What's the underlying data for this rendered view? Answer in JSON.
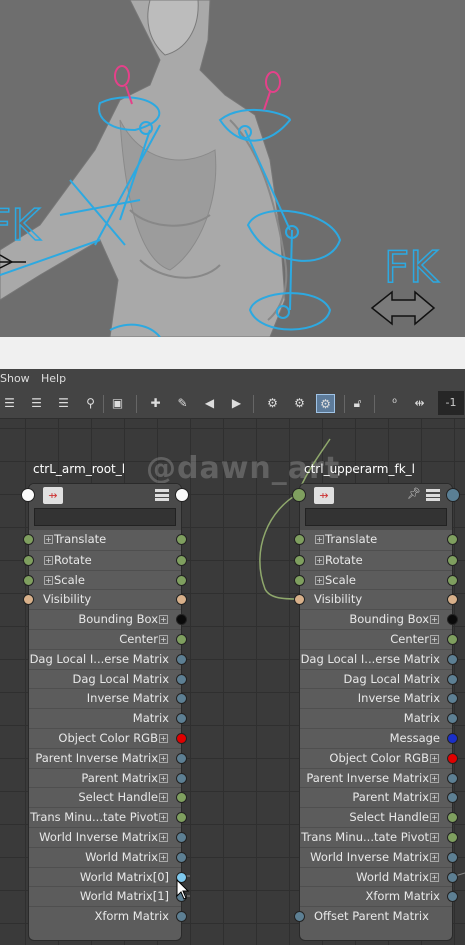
{
  "viewport": {
    "fk_label": "FK",
    "fk_label_left": "FK",
    "colors": {
      "rig": "#2da9e1",
      "locator": "#e5418a",
      "background": "#6e6e6e"
    }
  },
  "menu": {
    "items": [
      "Show",
      "Help"
    ]
  },
  "toolbar": {
    "icons": [
      "layout-icon",
      "list-icon",
      "columns-icon",
      "search-icon",
      "frame-icon",
      "add-node-icon",
      "edit-node-icon",
      "prev-icon",
      "next-icon",
      "input-connections-icon",
      "output-connections-icon",
      "graph-icon",
      "lock-icon",
      "zero-icon",
      "spread-icon"
    ],
    "zoom_value": "-1"
  },
  "canvas": {
    "watermark": "@dawn_art",
    "nodes": [
      {
        "title": "ctrL_arm_root_l",
        "rows": [
          {
            "label": "Translate",
            "side": "in",
            "plus": true,
            "left": "green",
            "right": "green"
          },
          {
            "label": "Rotate",
            "side": "in",
            "plus": true,
            "left": "green",
            "right": "green"
          },
          {
            "label": "Scale",
            "side": "in",
            "plus": true,
            "left": "green",
            "right": "green"
          },
          {
            "label": "Visibility",
            "side": "in",
            "plus": false,
            "left": "tan",
            "right": "tan"
          },
          {
            "label": "Bounding Box",
            "side": "out",
            "plus": true,
            "left": "",
            "right": "black"
          },
          {
            "label": "Center",
            "side": "out",
            "plus": true,
            "left": "",
            "right": "green"
          },
          {
            "label": "Dag Local I...erse Matrix",
            "side": "out",
            "plus": false,
            "left": "",
            "right": "blue"
          },
          {
            "label": "Dag Local Matrix",
            "side": "out",
            "plus": false,
            "left": "",
            "right": "blue"
          },
          {
            "label": "Inverse Matrix",
            "side": "out",
            "plus": false,
            "left": "",
            "right": "blue"
          },
          {
            "label": "Matrix",
            "side": "out",
            "plus": false,
            "left": "",
            "right": "blue"
          },
          {
            "label": "Object Color RGB",
            "side": "out",
            "plus": true,
            "left": "",
            "right": "red"
          },
          {
            "label": "Parent Inverse Matrix",
            "side": "out",
            "plus": true,
            "left": "",
            "right": "blue"
          },
          {
            "label": "Parent Matrix",
            "side": "out",
            "plus": true,
            "left": "",
            "right": "blue"
          },
          {
            "label": "Select Handle",
            "side": "out",
            "plus": true,
            "left": "",
            "right": "green"
          },
          {
            "label": "Trans Minu...tate Pivot",
            "side": "out",
            "plus": true,
            "left": "",
            "right": "green"
          },
          {
            "label": "World Inverse Matrix",
            "side": "out",
            "plus": true,
            "left": "",
            "right": "blue"
          },
          {
            "label": "World Matrix",
            "side": "out",
            "plus": true,
            "left": "",
            "right": "blue"
          },
          {
            "label": "World Matrix[0]",
            "side": "out",
            "plus": false,
            "left": "",
            "right": "hl"
          },
          {
            "label": "World Matrix[1]",
            "side": "out",
            "plus": false,
            "left": "",
            "right": "blue"
          },
          {
            "label": "Xform Matrix",
            "side": "out",
            "plus": false,
            "left": "",
            "right": "blue"
          }
        ]
      },
      {
        "title": "ctrl_upperarm_fk_l",
        "rows": [
          {
            "label": "Translate",
            "side": "in",
            "plus": true,
            "left": "green",
            "right": "green"
          },
          {
            "label": "Rotate",
            "side": "in",
            "plus": true,
            "left": "green",
            "right": "green"
          },
          {
            "label": "Scale",
            "side": "in",
            "plus": true,
            "left": "green",
            "right": "green"
          },
          {
            "label": "Visibility",
            "side": "in",
            "plus": false,
            "left": "tan",
            "right": "tan"
          },
          {
            "label": "Bounding Box",
            "side": "out",
            "plus": true,
            "left": "",
            "right": "black"
          },
          {
            "label": "Center",
            "side": "out",
            "plus": true,
            "left": "",
            "right": "green"
          },
          {
            "label": "Dag Local I...erse Matrix",
            "side": "out",
            "plus": false,
            "left": "",
            "right": "blue"
          },
          {
            "label": "Dag Local Matrix",
            "side": "out",
            "plus": false,
            "left": "",
            "right": "blue"
          },
          {
            "label": "Inverse Matrix",
            "side": "out",
            "plus": false,
            "left": "",
            "right": "blue"
          },
          {
            "label": "Matrix",
            "side": "out",
            "plus": false,
            "left": "",
            "right": "blue"
          },
          {
            "label": "Message",
            "side": "out",
            "plus": false,
            "left": "",
            "right": "navy"
          },
          {
            "label": "Object Color RGB",
            "side": "out",
            "plus": true,
            "left": "",
            "right": "red"
          },
          {
            "label": "Parent Inverse Matrix",
            "side": "out",
            "plus": true,
            "left": "",
            "right": "blue"
          },
          {
            "label": "Parent Matrix",
            "side": "out",
            "plus": true,
            "left": "",
            "right": "blue"
          },
          {
            "label": "Select Handle",
            "side": "out",
            "plus": true,
            "left": "",
            "right": "green"
          },
          {
            "label": "Trans Minu...tate Pivot",
            "side": "out",
            "plus": true,
            "left": "",
            "right": "green"
          },
          {
            "label": "World Inverse Matrix",
            "side": "out",
            "plus": true,
            "left": "",
            "right": "blue"
          },
          {
            "label": "World Matrix",
            "side": "out",
            "plus": true,
            "left": "",
            "right": "blue"
          },
          {
            "label": "Xform Matrix",
            "side": "out",
            "plus": false,
            "left": "",
            "right": "blue"
          },
          {
            "label": "Offset Parent Matrix",
            "side": "in",
            "plus": false,
            "left": "blue",
            "right": ""
          }
        ]
      }
    ]
  }
}
